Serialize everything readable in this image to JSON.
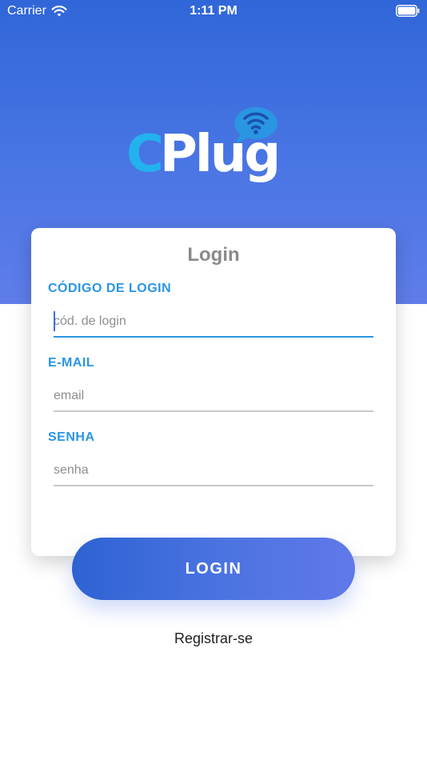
{
  "status_bar": {
    "carrier": "Carrier",
    "time": "1:11 PM"
  },
  "logo": {
    "text_c": "C",
    "text_plug": "Plug"
  },
  "colors": {
    "primary_blue": "#3066d8",
    "accent_blue": "#2a95e3",
    "title_gray": "#8a8a8a"
  },
  "login_card": {
    "title": "Login",
    "fields": [
      {
        "label": "CÓDIGO DE LOGIN",
        "placeholder": "cód. de login",
        "value": ""
      },
      {
        "label": "E-MAIL",
        "placeholder": "email",
        "value": ""
      },
      {
        "label": "SENHA",
        "placeholder": "senha",
        "value": ""
      }
    ]
  },
  "login_button": {
    "label": "LOGIN"
  },
  "register_link": {
    "label": "Registrar-se"
  }
}
